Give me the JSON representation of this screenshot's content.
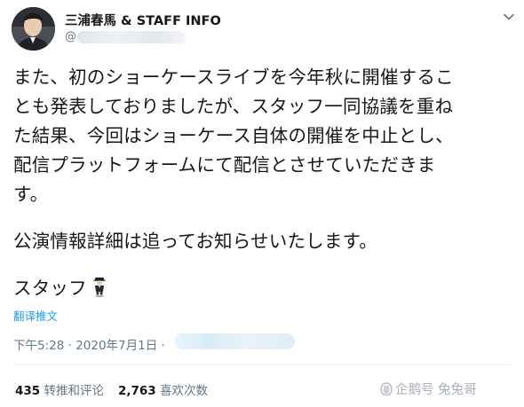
{
  "author": {
    "display_name": "三浦春馬 & STAFF INFO",
    "handle_prefix": "@"
  },
  "tweet": {
    "lines": [
      "また、初のショーケースライブを今年秋に開催するこ",
      "とも発表しておりましたが、スタッフ一同協議を重ね",
      "た結果、今回はショーケース自体の開催を中止とし、",
      "配信プラットフォームにて配信とさせていただきま",
      "す。",
      "公演情報詳細は追ってお知らせいたします。",
      "スタッフ"
    ],
    "signature_emoji": "man-in-business-suit-levitating"
  },
  "translate_link": "翻译推文",
  "timestamp": "下午5:28 · 2020年7月1日 ·",
  "stats": {
    "retweets_count": "435",
    "retweets_label": "转推和评论",
    "likes_count": "2,763",
    "likes_label": "喜欢次数"
  },
  "watermark": "企鹅号 兔兔哥",
  "colors": {
    "text": "#14171a",
    "secondary": "#657786",
    "link": "#1da1f2",
    "divider": "#e6ecf0"
  }
}
